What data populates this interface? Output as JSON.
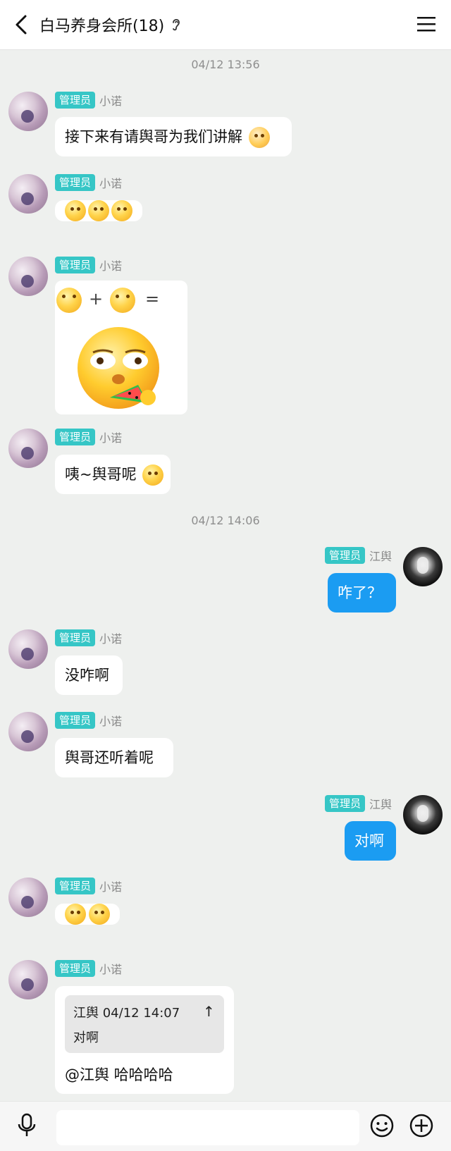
{
  "header": {
    "title": "白马养身会所(18)",
    "icons": {
      "back": "back-chevron-icon",
      "ear": "ear-icon",
      "menu": "hamburger-menu-icon"
    }
  },
  "timestamps": [
    "04/12 13:56",
    "04/12 14:06"
  ],
  "badge_label": "管理员",
  "users": {
    "left": "小诺",
    "right": "江舆"
  },
  "messages": [
    {
      "side": "left",
      "type": "text",
      "text": "接下来有请舆哥为我们讲解",
      "trailing_emoji": "sticker-emoji"
    },
    {
      "side": "left",
      "type": "emoji-row",
      "emojis": [
        "cover-mouth-emoji",
        "cover-mouth-emoji",
        "cover-mouth-emoji"
      ]
    },
    {
      "side": "left",
      "type": "equation-sticker",
      "operators": [
        "+",
        "="
      ]
    },
    {
      "side": "left",
      "type": "text",
      "text": "咦~舆哥呢",
      "trailing_emoji": "shy-emoji"
    },
    {
      "side": "right",
      "type": "text",
      "text": "咋了？"
    },
    {
      "side": "left",
      "type": "text",
      "text": "没咋啊"
    },
    {
      "side": "left",
      "type": "text",
      "text": "舆哥还听着呢"
    },
    {
      "side": "right",
      "type": "text",
      "text": "对啊"
    },
    {
      "side": "left",
      "type": "emoji-row",
      "emojis": [
        "smile-emoji",
        "smile-emoji"
      ]
    },
    {
      "side": "left",
      "type": "reply",
      "quote": {
        "header": "江舆 04/12 14:07",
        "body": "对啊",
        "arrow": "↑"
      },
      "text": "@江舆 哈哈哈哈"
    }
  ],
  "bottombar": {
    "icons": {
      "mic": "microphone-icon",
      "emoji": "emoji-icon",
      "plus": "plus-circle-icon"
    },
    "input_value": ""
  },
  "colors": {
    "badge": "#36c6c6",
    "blue_bubble": "#1b9cf2",
    "background": "#eef0ee"
  }
}
